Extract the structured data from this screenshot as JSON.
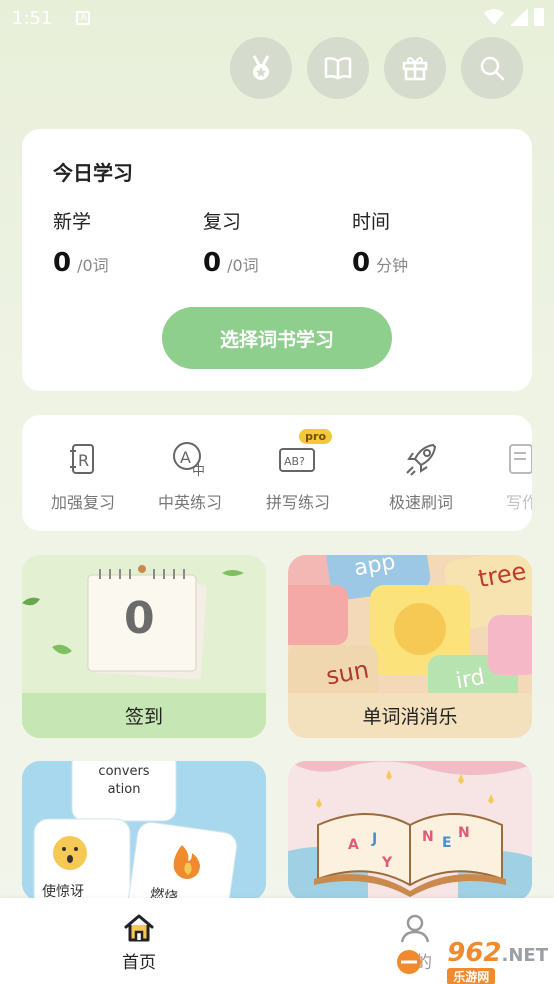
{
  "status_bar": {
    "time": "1:51"
  },
  "top_icons": [
    "medal-icon",
    "book-icon",
    "gift-icon",
    "search-icon"
  ],
  "today": {
    "title": "今日学习",
    "stats": [
      {
        "label": "新学",
        "value": "0",
        "unit": "/0词"
      },
      {
        "label": "复习",
        "value": "0",
        "unit": "/0词"
      },
      {
        "label": "时间",
        "value": "0",
        "unit": "分钟"
      }
    ],
    "button_label": "选择词书学习"
  },
  "tools": [
    {
      "label": "加强复习",
      "icon": "review-icon"
    },
    {
      "label": "中英练习",
      "icon": "translate-icon"
    },
    {
      "label": "拼写练习",
      "icon": "spell-icon",
      "badge": "pro"
    },
    {
      "label": "极速刷词",
      "icon": "rocket-icon"
    },
    {
      "label": "写作",
      "icon": "writing-icon"
    }
  ],
  "games": [
    {
      "label": "签到",
      "art_number": "0"
    },
    {
      "label": "单词消消乐",
      "tiles": [
        "app",
        "tree",
        "sun",
        "ird"
      ]
    },
    {
      "label": "",
      "tiles": [
        "convers\nation",
        "使惊讶",
        "燃烧"
      ]
    },
    {
      "label": "",
      "letters": [
        "A",
        "J",
        "Y",
        "N",
        "E",
        "N"
      ]
    }
  ],
  "nav": [
    {
      "label": "首页",
      "icon": "home-icon"
    },
    {
      "label": "我的",
      "icon": "user-icon"
    }
  ],
  "watermark": {
    "text": "962",
    "suffix": ".NET",
    "sub": "乐游网"
  },
  "colors": {
    "accent": "#8fcf8e",
    "pro": "#f2c93a"
  }
}
